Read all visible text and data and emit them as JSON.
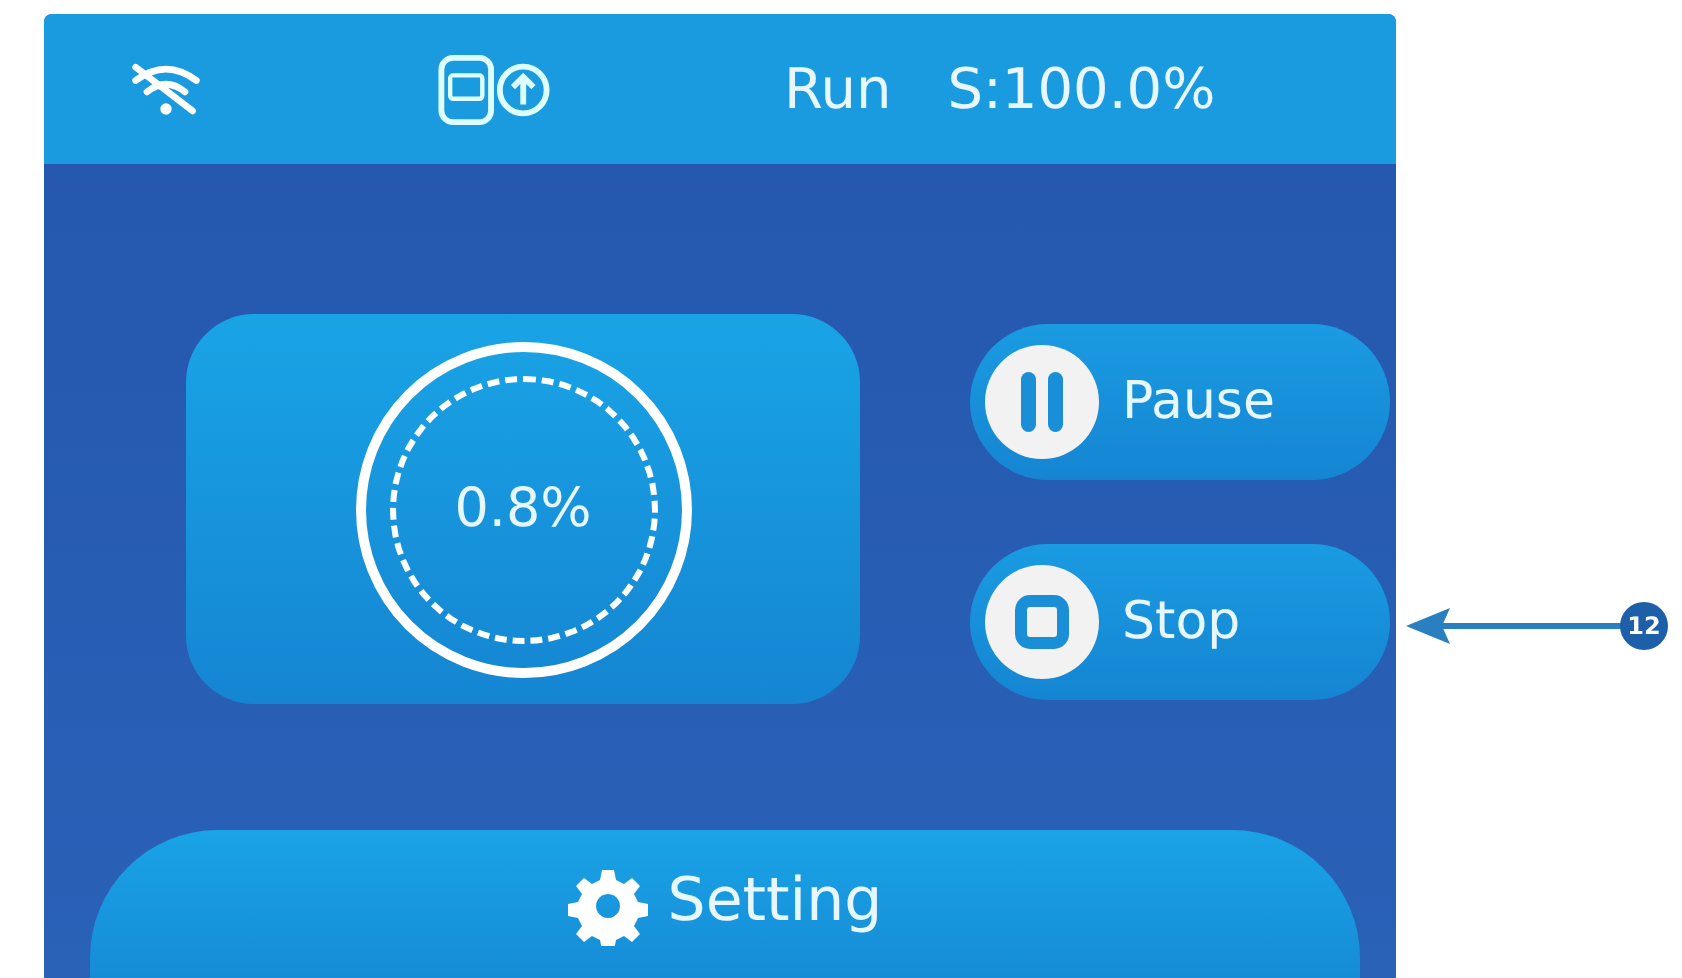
{
  "status_bar": {
    "wifi": {
      "connected": false
    },
    "state": "Run",
    "speed": "S:100.0%"
  },
  "progress": {
    "text": "0.8%"
  },
  "buttons": [
    {
      "kind": "pause",
      "label": "Pause"
    },
    {
      "kind": "stop",
      "label": "Stop"
    }
  ],
  "setting": {
    "label": "Setting"
  },
  "callout": {
    "number": "12"
  }
}
